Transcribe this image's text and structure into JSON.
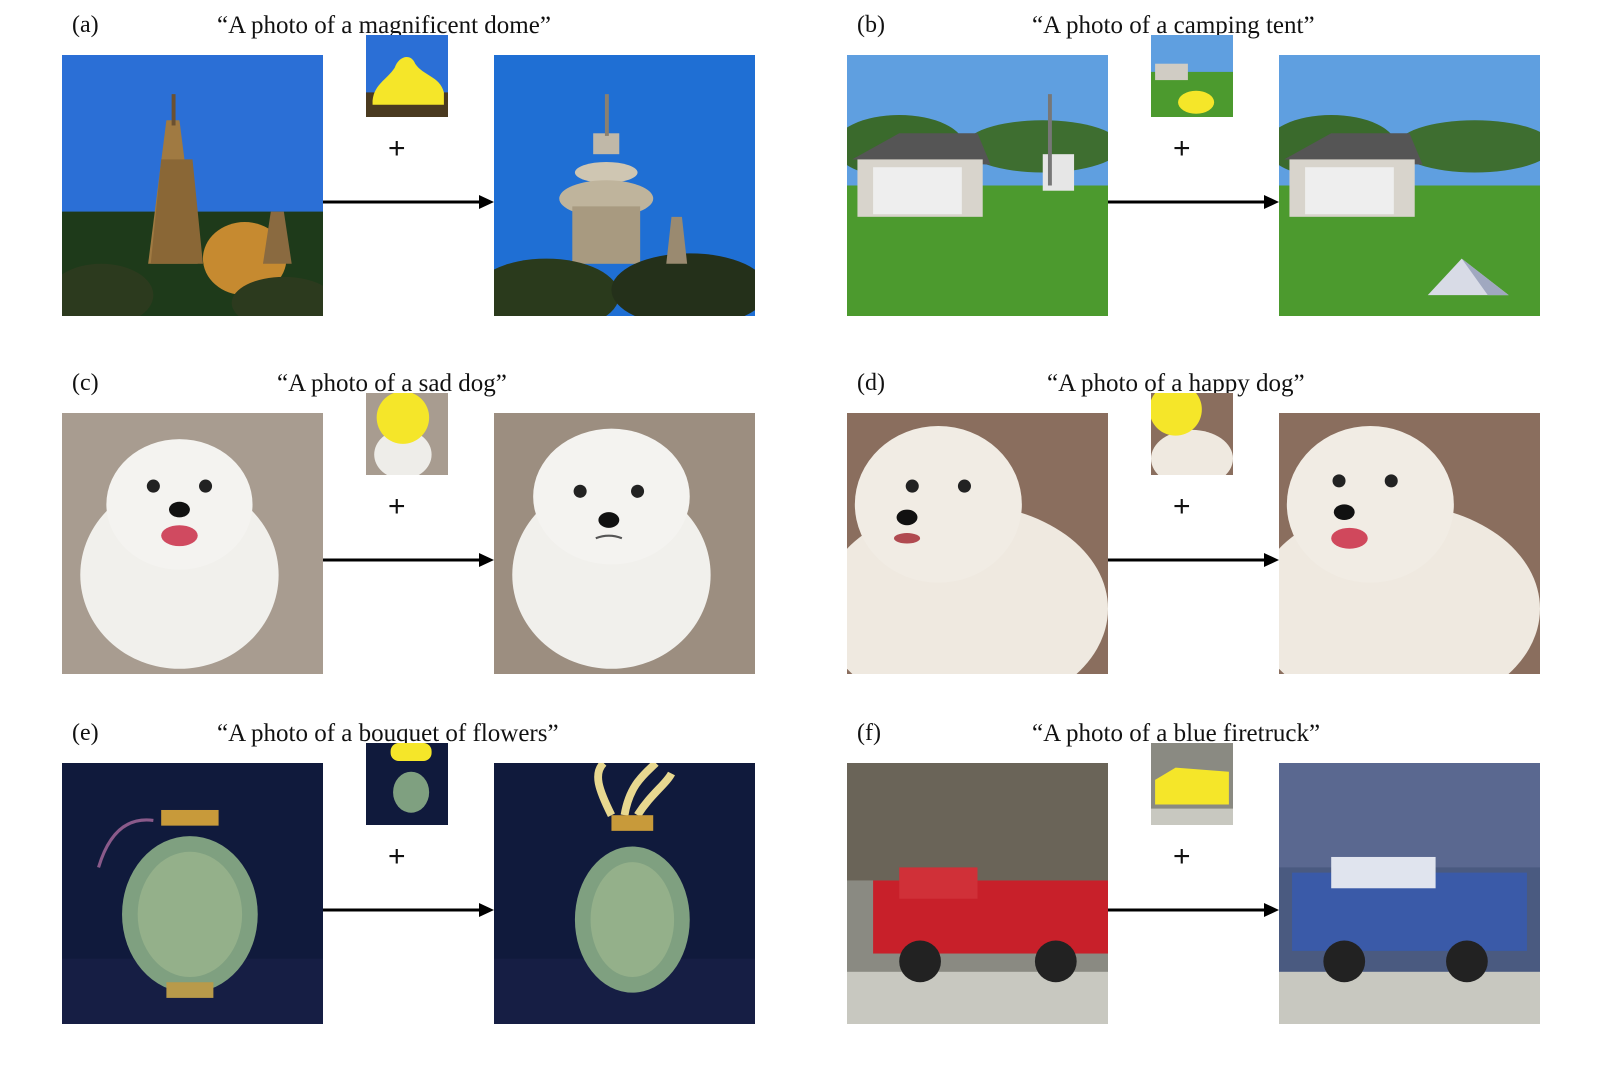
{
  "panels": [
    {
      "label": "(a)",
      "caption": "“A photo of a magnificent dome”"
    },
    {
      "label": "(b)",
      "caption": "“A photo of a camping tent”"
    },
    {
      "label": "(c)",
      "caption": "“A photo of a sad dog”"
    },
    {
      "label": "(d)",
      "caption": "“A photo of a happy dog”"
    },
    {
      "label": "(e)",
      "caption": "“A photo of a bouquet of flowers”"
    },
    {
      "label": "(f)",
      "caption": "“A photo of a blue firetruck”"
    }
  ],
  "plus_symbol": "+",
  "mask_color": "#f5e629"
}
